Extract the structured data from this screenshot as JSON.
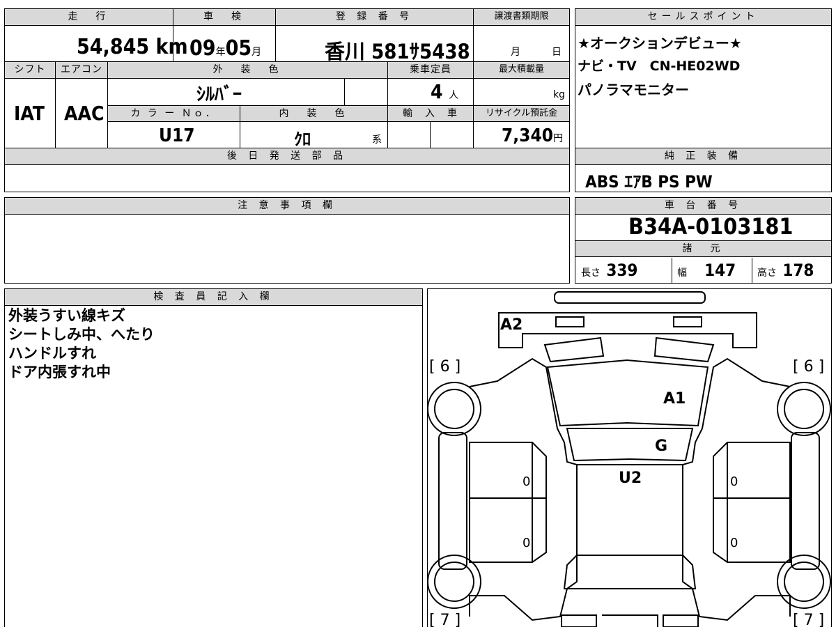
{
  "top_section": {
    "mileage": {
      "label": "走　行",
      "value": "54,845",
      "unit": "km"
    },
    "inspection": {
      "label": "車　検",
      "year": "09",
      "year_unit": "年",
      "month": "05",
      "month_unit": "月"
    },
    "registration": {
      "label": "登 録 番 号",
      "value": "香川 581ｻ5438"
    },
    "transfer_deadline": {
      "label": "譲渡書類期限",
      "month_unit": "月",
      "day_unit": "日"
    },
    "shift": {
      "label": "シフト",
      "value": "IAT"
    },
    "aircon": {
      "label": "エアコン",
      "value": "AAC"
    },
    "exterior_color": {
      "label": "外　装　色",
      "value": "ｼﾙﾊﾞｰ"
    },
    "capacity": {
      "label": "乗車定員",
      "value": "4",
      "unit": "人"
    },
    "max_load": {
      "label": "最大積載量",
      "unit": "kg"
    },
    "color_no": {
      "label": "カ ラ ー Ｎｏ．",
      "value": "U17"
    },
    "interior_color": {
      "label": "内　装　色",
      "value": "ｸﾛ",
      "suffix": "系"
    },
    "import": {
      "label": "輸　入　車"
    },
    "recycle": {
      "label": "リサイクル預託金",
      "value": "7,340",
      "unit": "円"
    },
    "later_parts": {
      "label": "後 日 発 送 部 品"
    }
  },
  "sales_points": {
    "label": "セールスポイント",
    "lines": [
      "★オークションデビュー★",
      "ナビ・TV　CN-HE02WD",
      "パノラマモニター"
    ]
  },
  "genuine_equipment": {
    "label": "純 正 装 備",
    "value": "ABS ｴｱB PS PW"
  },
  "notes": {
    "label": "注 意 事 項 欄"
  },
  "chassis": {
    "label": "車 台 番 号",
    "value": "B34A-0103181"
  },
  "specs": {
    "label": "諸　元",
    "length_label": "長さ",
    "length": "339",
    "width_label": "幅",
    "width": "147",
    "height_label": "高さ",
    "height": "178"
  },
  "inspector": {
    "label": "検 査 員 記 入 欄",
    "lines": [
      "外装うすい線キズ",
      "シートしみ中、へたり",
      "ハンドルすれ",
      "ドア内張すれ中"
    ]
  },
  "diagram": {
    "tire_fl": "[ 6 ]",
    "tire_fr": "[ 6 ]",
    "tire_rl": "[ 7 ]",
    "tire_rr": "[ 7 ]",
    "mark_a2": "A2",
    "mark_a1": "A1",
    "mark_g": "G",
    "mark_u2": "U2",
    "door_left_front": "0",
    "door_left_rear": "0",
    "door_right_front": "0",
    "door_right_rear": "0"
  }
}
